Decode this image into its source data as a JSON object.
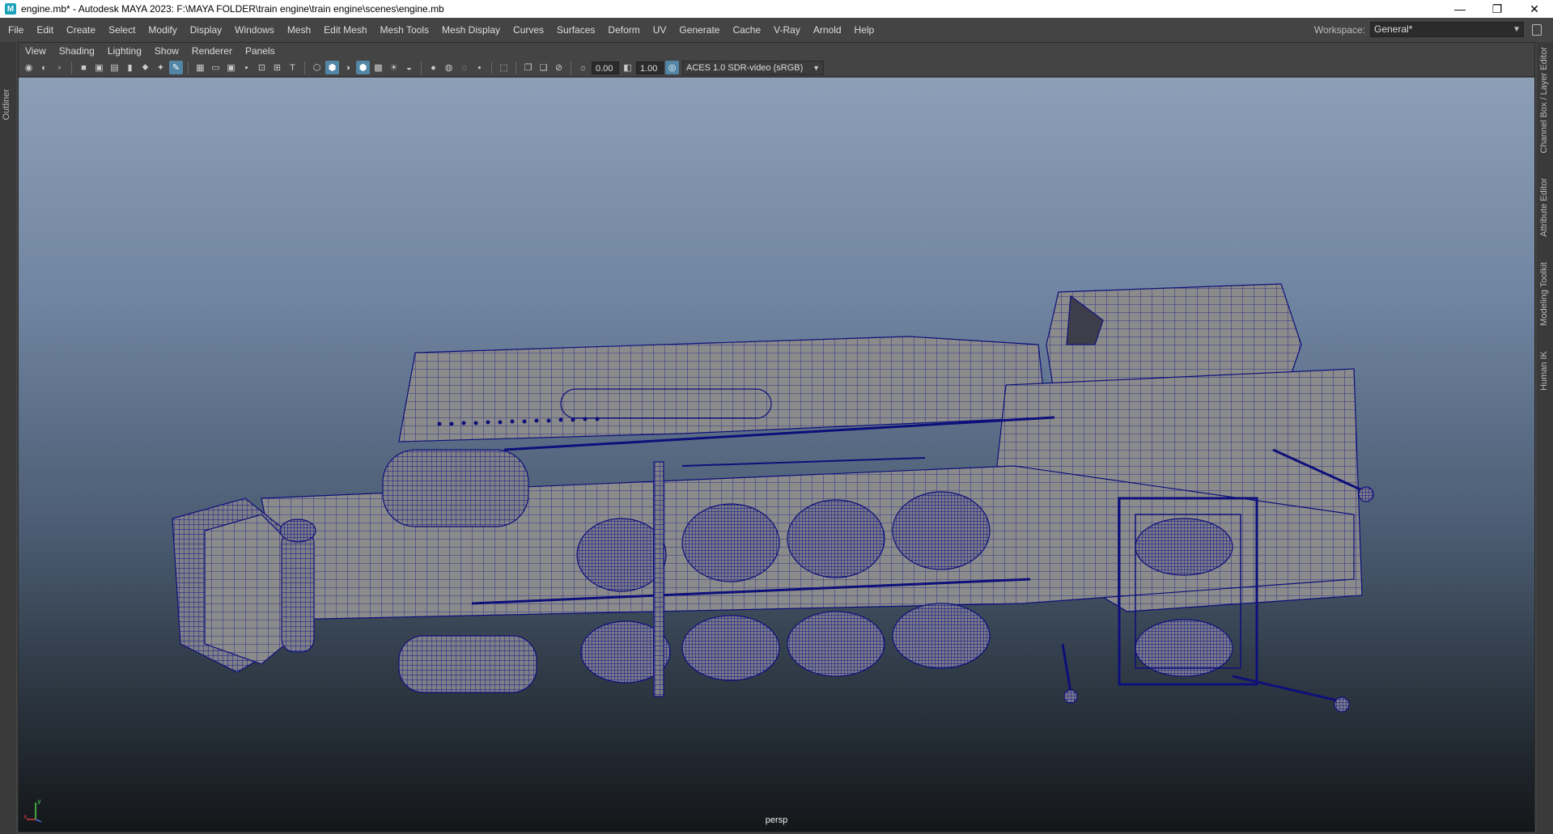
{
  "window": {
    "app_icon_letter": "M",
    "title": "engine.mb* - Autodesk MAYA 2023: F:\\MAYA FOLDER\\train engine\\train engine\\scenes\\engine.mb",
    "minimize": "—",
    "maximize": "❐",
    "close": "✕"
  },
  "menubar": {
    "items": [
      "File",
      "Edit",
      "Create",
      "Select",
      "Modify",
      "Display",
      "Windows",
      "Mesh",
      "Edit Mesh",
      "Mesh Tools",
      "Mesh Display",
      "Curves",
      "Surfaces",
      "Deform",
      "UV",
      "Generate",
      "Cache",
      "V-Ray",
      "Arnold",
      "Help"
    ]
  },
  "workspace": {
    "label": "Workspace:",
    "value": "General*"
  },
  "left_strip": {
    "label": "Outliner"
  },
  "right_tabs": [
    "Channel Box / Layer Editor",
    "Attribute Editor",
    "Modeling Toolkit",
    "Human IK"
  ],
  "panel": {
    "menu": [
      "View",
      "Shading",
      "Lighting",
      "Show",
      "Renderer",
      "Panels"
    ],
    "exposure": "0.00",
    "gamma": "1.00",
    "color_management": "ACES 1.0 SDR-video (sRGB)"
  },
  "viewport": {
    "camera": "persp",
    "axis_x": "x",
    "axis_y": "y"
  },
  "colors": {
    "wireframe": "#0d0f7a",
    "mesh_fill": "#8a8a8a",
    "active_tool": "#5285a6",
    "title_bar": "#ffffff"
  }
}
